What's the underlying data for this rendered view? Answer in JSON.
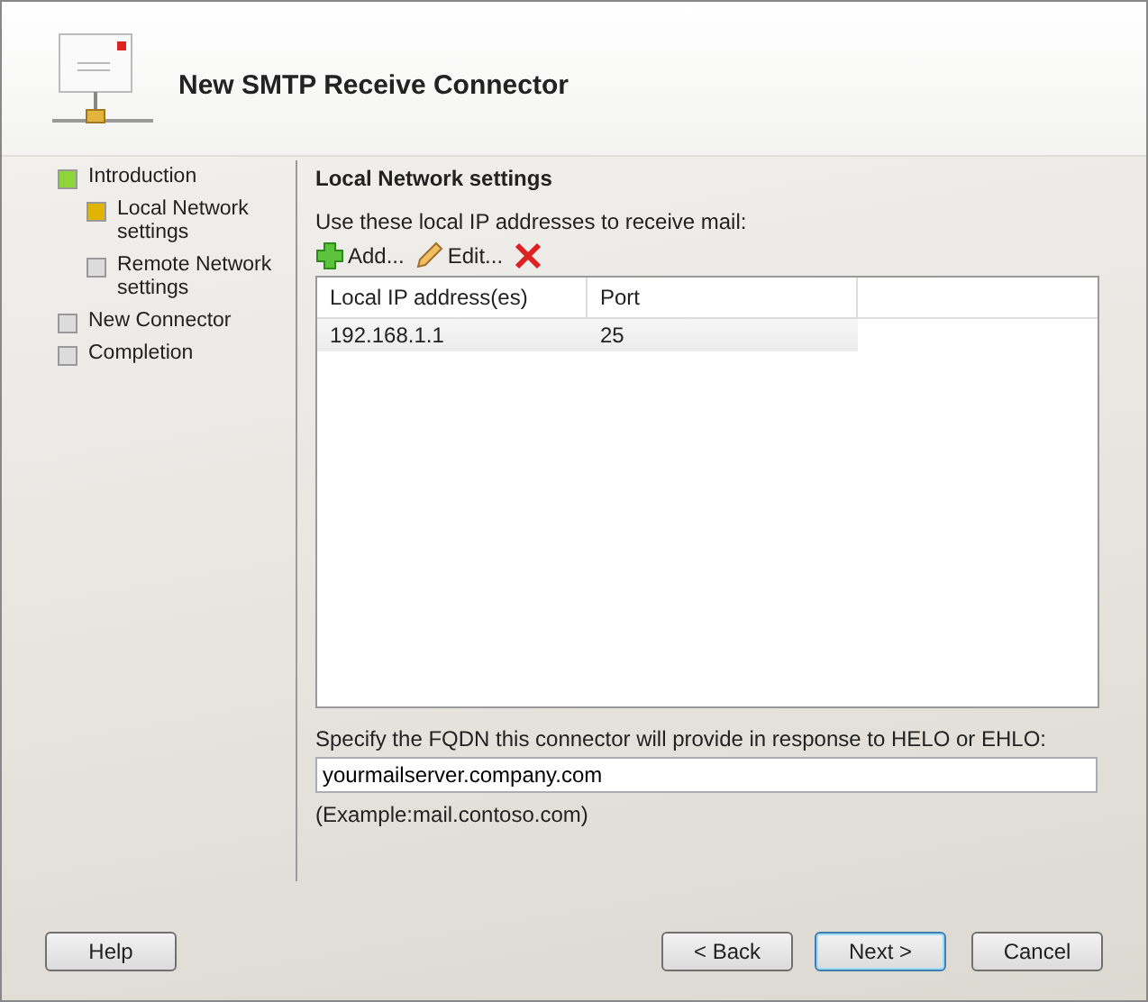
{
  "header": {
    "title": "New SMTP Receive Connector"
  },
  "steps": [
    {
      "label": "Introduction",
      "kind": "done",
      "children": [
        {
          "label": "Local Network settings",
          "kind": "current"
        },
        {
          "label": "Remote Network settings",
          "kind": "pending"
        }
      ]
    },
    {
      "label": "New Connector",
      "kind": "pending"
    },
    {
      "label": "Completion",
      "kind": "pending"
    }
  ],
  "page": {
    "heading": "Local Network settings",
    "intro": "Use these local IP addresses to receive mail:",
    "toolbar": [
      {
        "kind": "add",
        "label": "Add..."
      },
      {
        "kind": "edit",
        "label": "Edit..."
      },
      {
        "kind": "remove"
      }
    ],
    "table": {
      "columns": [
        "Local IP address(es)",
        "Port"
      ],
      "rows": [
        {
          "cells": [
            "192.168.1.1",
            "25"
          ],
          "selected": false
        }
      ]
    },
    "fqdn_label": "Specify the FQDN this connector will provide in response to HELO or EHLO:",
    "fqdn_value": "yourmailserver.company.com",
    "example": "(Example:mail.contoso.com)"
  },
  "buttons": {
    "help": "Help",
    "back": "< Back",
    "next": "Next >",
    "cancel": "Cancel"
  }
}
